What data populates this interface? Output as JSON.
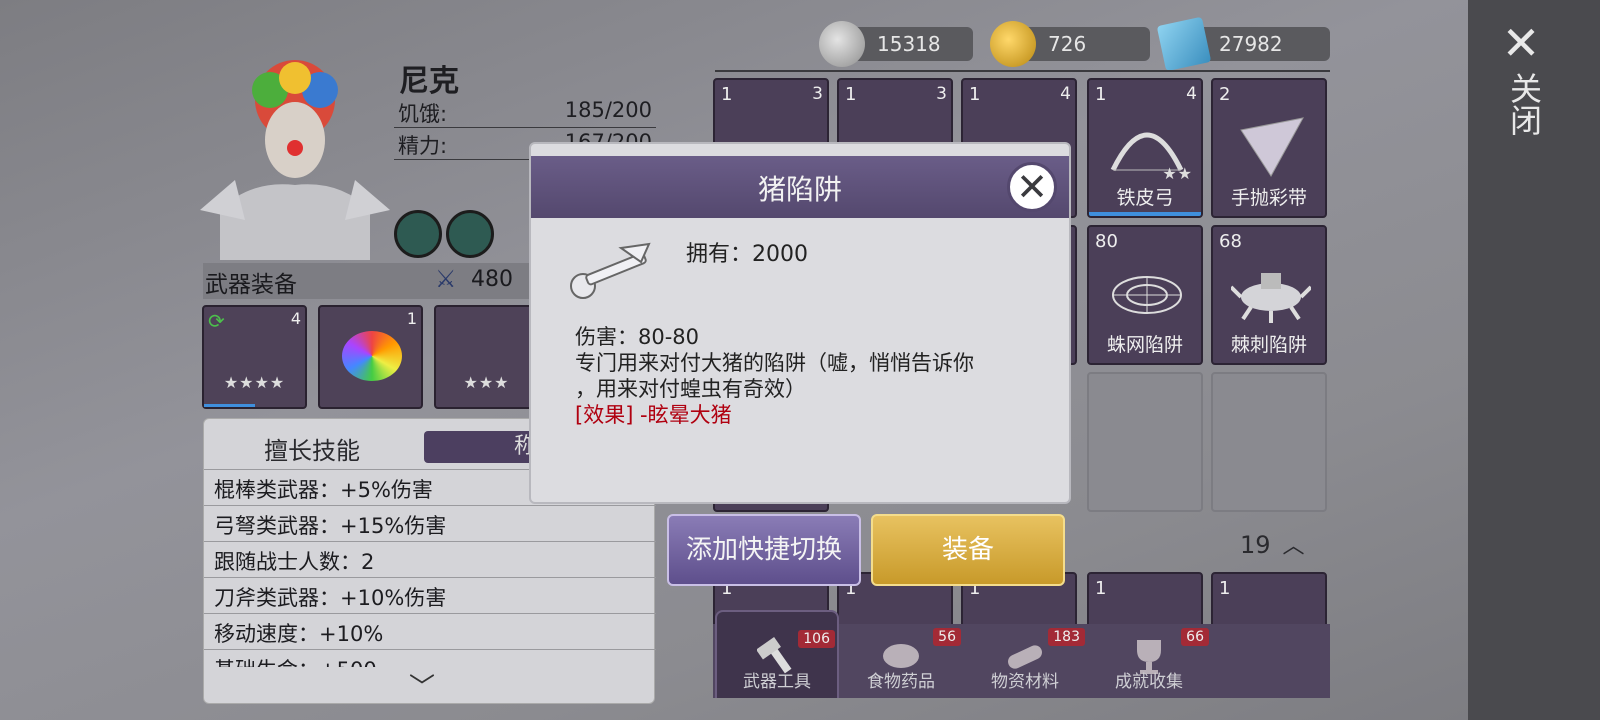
{
  "currencies": [
    {
      "icon": "silver-coin-icon",
      "value": "15318"
    },
    {
      "icon": "gold-coin-icon",
      "value": "726"
    },
    {
      "icon": "ticket-icon",
      "value": "27982"
    }
  ],
  "close": {
    "label": "关闭"
  },
  "character": {
    "name": "尼克",
    "stats": [
      {
        "label": "饥饿:",
        "value": "185/200"
      },
      {
        "label": "精力:",
        "value": "167/200"
      }
    ]
  },
  "weapons": {
    "title": "武器装备",
    "power": "480",
    "slots": [
      {
        "level": "4",
        "stars": "★★★★"
      },
      {
        "level": "1",
        "stars": ""
      },
      {
        "level": "",
        "stars": "★★★"
      }
    ]
  },
  "skills": {
    "tab_active": "擅长技能",
    "tab_other": "称号",
    "rows": [
      "棍棒类武器：+5%伤害",
      "弓弩类武器：+15%伤害",
      "跟随战士人数：2",
      "刀斧类武器：+10%伤害",
      "移动速度：+10%",
      "基础生命：+500"
    ]
  },
  "inventory": {
    "row1": [
      {
        "count": "1",
        "level": "3",
        "name": ""
      },
      {
        "count": "1",
        "level": "3",
        "name": ""
      },
      {
        "count": "1",
        "level": "4",
        "name": ""
      },
      {
        "count": "1",
        "level": "4",
        "name": "铁皮弓",
        "stars": "★★"
      },
      {
        "count": "2",
        "level": "",
        "name": "手抛彩带"
      }
    ],
    "row2": [
      {
        "count": "80",
        "name": "蛛网陷阱"
      },
      {
        "count": "68",
        "name": "棘刺陷阱"
      }
    ],
    "count": "19",
    "row3_counts": [
      "1",
      "1",
      "1",
      "1",
      "1"
    ]
  },
  "tabs": [
    {
      "label": "武器工具",
      "badge": "106"
    },
    {
      "label": "食物药品",
      "badge": "56"
    },
    {
      "label": "物资材料",
      "badge": "183"
    },
    {
      "label": "成就收集",
      "badge": "66"
    }
  ],
  "modal": {
    "title": "猪陷阱",
    "own_label": "拥有：2000",
    "damage": "伤害：80-80",
    "description_line1": "专门用来对付大猪的陷阱（嘘，悄悄告诉你",
    "description_line2": "，用来对付蝗虫有奇效）",
    "effect": "[效果] -眩晕大猪"
  },
  "buttons": {
    "shortcut": "添加快捷切换",
    "equip": "装备"
  },
  "colors": {
    "modal_header": "#5e5180",
    "equip_button": "#d9ad3f",
    "effect_text": "#b00010"
  }
}
